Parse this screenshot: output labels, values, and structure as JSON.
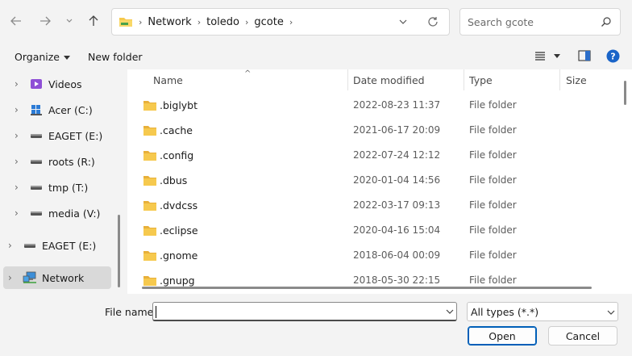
{
  "address": {
    "crumbs": [
      "Network",
      "toledo",
      "gcote"
    ]
  },
  "search": {
    "placeholder": "Search gcote"
  },
  "toolbar": {
    "organize_label": "Organize",
    "new_folder_label": "New folder"
  },
  "sidebar": {
    "items": [
      {
        "label": "Videos",
        "icon": "videos-icon"
      },
      {
        "label": "Acer (C:)",
        "icon": "windows-drive-icon"
      },
      {
        "label": "EAGET (E:)",
        "icon": "drive-icon"
      },
      {
        "label": "roots (R:)",
        "icon": "drive-icon"
      },
      {
        "label": "tmp (T:)",
        "icon": "drive-icon"
      },
      {
        "label": "media (V:)",
        "icon": "drive-icon"
      },
      {
        "label": "EAGET (E:)",
        "icon": "drive-icon"
      },
      {
        "label": "Network",
        "icon": "network-icon"
      }
    ]
  },
  "columns": {
    "name": "Name",
    "date": "Date modified",
    "type": "Type",
    "size": "Size"
  },
  "files": [
    {
      "name": ".biglybt",
      "date": "2022-08-23 11:37",
      "type": "File folder"
    },
    {
      "name": ".cache",
      "date": "2021-06-17 20:09",
      "type": "File folder"
    },
    {
      "name": ".config",
      "date": "2022-07-24 12:12",
      "type": "File folder"
    },
    {
      "name": ".dbus",
      "date": "2020-01-04 14:56",
      "type": "File folder"
    },
    {
      "name": ".dvdcss",
      "date": "2022-03-17 09:13",
      "type": "File folder"
    },
    {
      "name": ".eclipse",
      "date": "2020-04-16 15:04",
      "type": "File folder"
    },
    {
      "name": ".gnome",
      "date": "2018-06-04 00:09",
      "type": "File folder"
    },
    {
      "name": ".gnupg",
      "date": "2018-05-30 22:15",
      "type": "File folder"
    }
  ],
  "footer": {
    "file_name_label": "File name:",
    "file_name_value": "",
    "file_type": "All types (*.*)",
    "open_label": "Open",
    "cancel_label": "Cancel"
  },
  "colors": {
    "accent": "#005fb8",
    "folder": "#f6c94e",
    "selected_bg": "#d9d9d9"
  }
}
